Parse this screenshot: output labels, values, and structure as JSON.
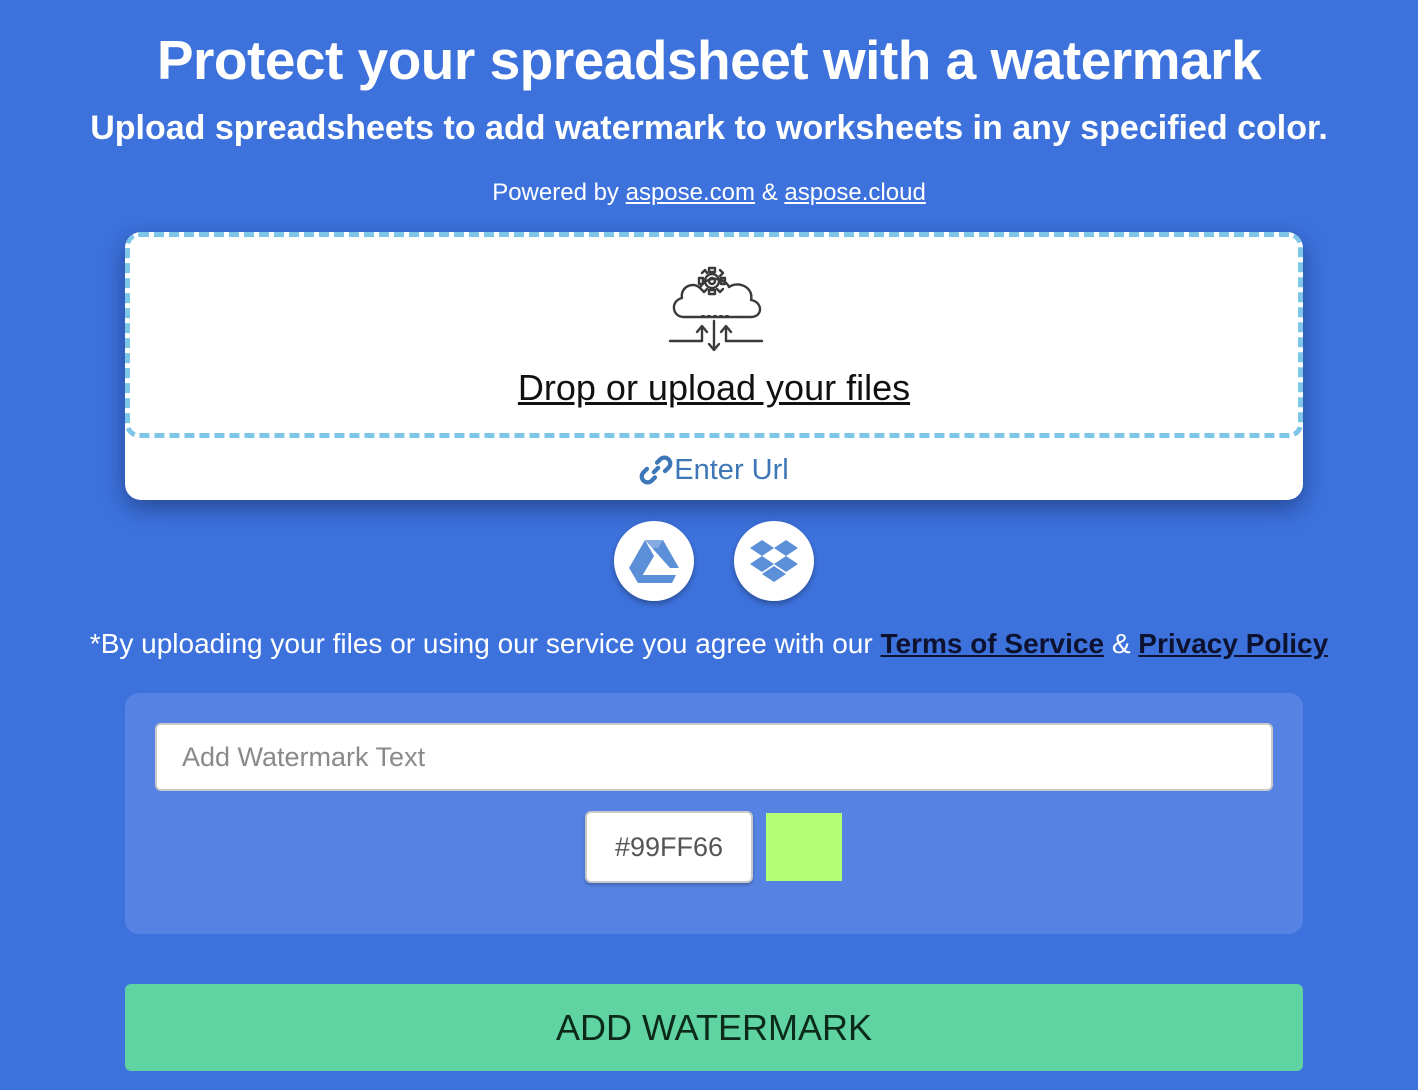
{
  "header": {
    "title": "Protect your spreadsheet with a watermark",
    "subtitle": "Upload spreadsheets to add watermark to worksheets in any specified color.",
    "powered_prefix": "Powered by",
    "powered_link1": "aspose.com",
    "powered_amp": "&",
    "powered_link2": "aspose.cloud"
  },
  "upload": {
    "icon": "cloud-gear-upload-icon",
    "drop_label": "Drop or upload your files",
    "enter_url_label": "Enter Url",
    "enter_url_icon": "link-icon",
    "cloud_sources": [
      "google-drive-icon",
      "dropbox-icon"
    ]
  },
  "terms": {
    "prefix": "*By uploading your files or using our service you agree with our",
    "terms_link": "Terms of Service",
    "amp": "&",
    "privacy_link": "Privacy Policy"
  },
  "options": {
    "watermark_placeholder": "Add Watermark Text",
    "watermark_value": "",
    "color_value": "#99FF66",
    "swatch_color": "#b2ff75"
  },
  "actions": {
    "submit_label": "ADD WATERMARK"
  },
  "colors": {
    "background": "#3d72dd",
    "panel": "#5683e3",
    "button": "#5fd3a2",
    "dropzone_border": "#7ec6e8",
    "link_blue": "#3e77b8"
  }
}
